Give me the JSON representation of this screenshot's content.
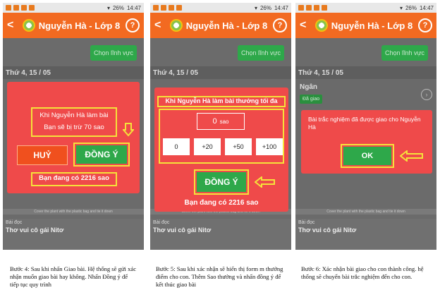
{
  "status": {
    "time": "14:47",
    "battery": "26%"
  },
  "app": {
    "title": "Nguyễn Hà - Lớp 8",
    "back": "<",
    "help": "?"
  },
  "pick_button": "Chọn lĩnh vực",
  "date": "Thứ 4, 15 / 05",
  "bottom_strip": "Cover the plant with the plastic bag and tie it down",
  "category": "Bài đọc",
  "poem": "Thơ vui cô gái Nitơ",
  "screen1": {
    "message_line1": "Khi Nguyễn Hà làm bài",
    "message_line2": "Bạn sẽ bị trừ 70 sao",
    "cancel": "HUỶ",
    "confirm": "ĐỒNG Ý",
    "balance": "Bạn đang có 2216 sao"
  },
  "screen2": {
    "heading": "Khi Nguyễn Hà làm bài thưởng tối đa",
    "input_value": "0",
    "input_unit": "sao",
    "options": [
      "0",
      "+20",
      "+50",
      "+100"
    ],
    "confirm": "ĐỒNG Ý",
    "balance": "Bạn đang có 2216 sao"
  },
  "screen3": {
    "card_title": "Ngân",
    "card_badge": "Đã giao",
    "message": "Bài trắc nghiệm đã được giao cho Nguyễn Hà",
    "ok": "OK"
  },
  "captions": {
    "step4": "Bước 4: Sau khi nhấn Giao bài. Hệ thống sẽ gửi xác nhận muốn giao bài hay không. Nhấn Đồng ý để tiếp tục quy trình",
    "step5": "Bước 5: Sau khi xác nhận sẽ hiển thị form m thưởng điểm cho con. Thêm Sao thưởng và nhấn đồng ý để kết thúc giao bài",
    "step6": "Bước 6: Xác nhận bài giao cho con thành công. hệ thống sẽ chuyển bài trắc nghiệm đến cho con."
  },
  "colors": {
    "appbar": "#f26a21",
    "modal": "#ef4a4a",
    "green": "#2ea84a",
    "highlight": "#f5e23a",
    "cancel": "#f0501e"
  }
}
